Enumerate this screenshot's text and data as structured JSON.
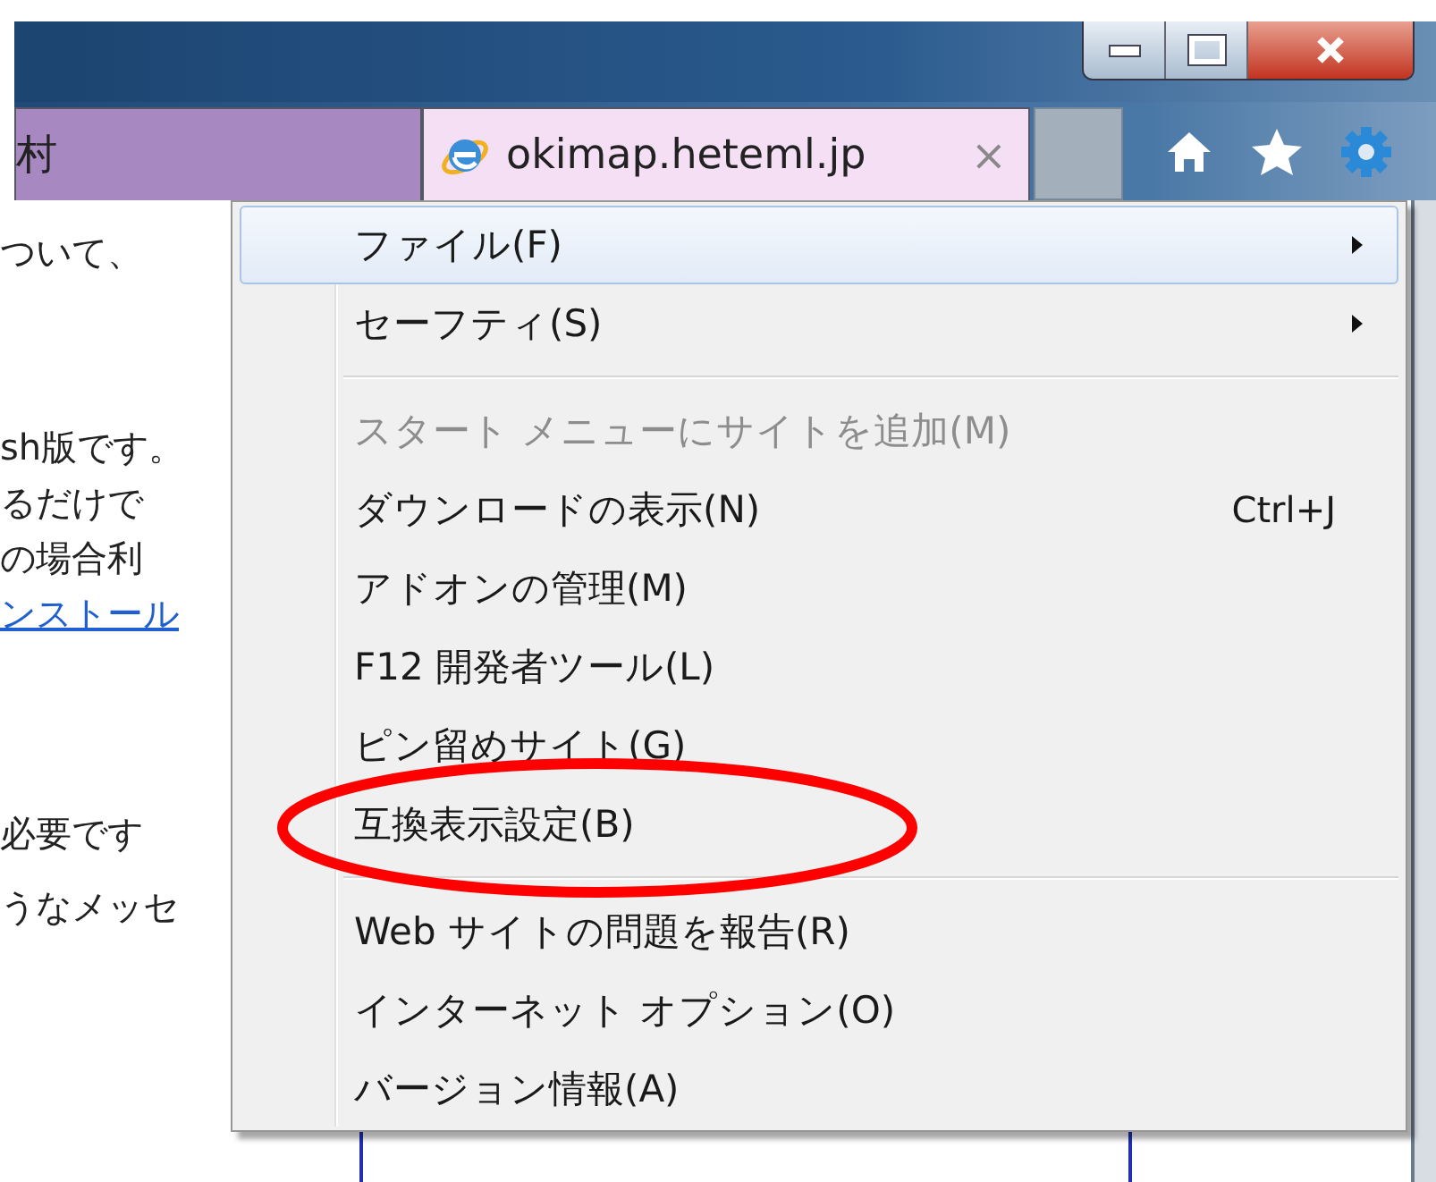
{
  "tabs": [
    {
      "label": "村",
      "selected": false
    },
    {
      "label": "okimap.heteml.jp",
      "selected": true,
      "close": "×"
    }
  ],
  "page": {
    "paragraphs": [
      [
        {
          "kind": "text",
          "text": "ついて、"
        }
      ],
      [
        {
          "kind": "text",
          "text": "sh版です。"
        },
        {
          "kind": "text",
          "text": "るだけで"
        },
        {
          "kind": "text",
          "text": "の場合利"
        },
        {
          "kind": "link",
          "text": "ンストール"
        }
      ],
      [
        {
          "kind": "text",
          "text": "必要です"
        }
      ],
      [
        {
          "kind": "text",
          "text": "うなメッセ"
        }
      ]
    ]
  },
  "menu": {
    "items": [
      {
        "kind": "item",
        "label": "ファイル(F)",
        "submenu": true,
        "selected": true,
        "disabled": false
      },
      {
        "kind": "item",
        "label": "セーフティ(S)",
        "submenu": true,
        "selected": false,
        "disabled": false
      },
      {
        "kind": "separator"
      },
      {
        "kind": "item",
        "label": "スタート メニューにサイトを追加(M)",
        "submenu": false,
        "selected": false,
        "disabled": true
      },
      {
        "kind": "item",
        "label": "ダウンロードの表示(N)",
        "shortcut": "Ctrl+J",
        "submenu": false,
        "selected": false,
        "disabled": false
      },
      {
        "kind": "item",
        "label": "アドオンの管理(M)",
        "submenu": false,
        "selected": false,
        "disabled": false
      },
      {
        "kind": "item",
        "label": "F12 開発者ツール(L)",
        "submenu": false,
        "selected": false,
        "disabled": false
      },
      {
        "kind": "item",
        "label": "ピン留めサイト(G)",
        "submenu": false,
        "selected": false,
        "disabled": false
      },
      {
        "kind": "item",
        "label": "互換表示設定(B)",
        "submenu": false,
        "selected": false,
        "disabled": false
      },
      {
        "kind": "separator"
      },
      {
        "kind": "item",
        "label": "Web サイトの問題を報告(R)",
        "submenu": false,
        "selected": false,
        "disabled": false
      },
      {
        "kind": "item",
        "label": "インターネット オプション(O)",
        "submenu": false,
        "selected": false,
        "disabled": false
      },
      {
        "kind": "item",
        "label": "バージョン情報(A)",
        "submenu": false,
        "selected": false,
        "disabled": false
      }
    ]
  },
  "annotation": {
    "kind": "ellipse",
    "color": "#ff0000"
  }
}
